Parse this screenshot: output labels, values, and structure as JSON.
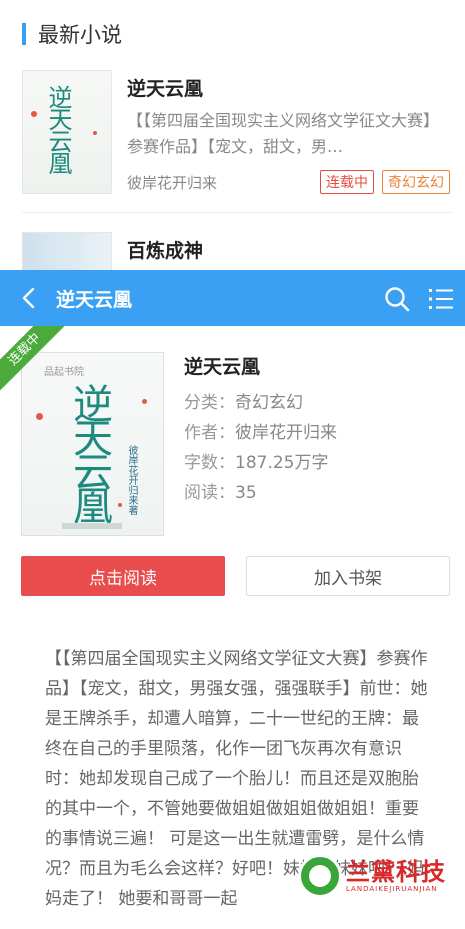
{
  "background": {
    "section_title": "最新小说",
    "books": [
      {
        "title": "逆天云凰",
        "cover_text": "逆天云凰",
        "description": "【【第四届全国现实主义网络文学征文大赛】参赛作品】【宠文，甜文，男…",
        "author": "彼岸花开归来",
        "tags": [
          "连载中",
          "奇幻玄幻"
        ]
      },
      {
        "title": "百炼成神"
      }
    ]
  },
  "header": {
    "title": "逆天云凰",
    "back_icon": "chevron-left-icon",
    "search_icon": "search-icon",
    "menu_icon": "list-menu-icon"
  },
  "detail": {
    "ribbon": "连载中",
    "cover": {
      "publisher": "品起书院",
      "title": "逆天云凰",
      "author": "彼岸花开归来著"
    },
    "title": "逆天云凰",
    "fields": [
      {
        "label": "分类：",
        "value": "奇幻玄幻"
      },
      {
        "label": "作者：",
        "value": "彼岸花开归来"
      },
      {
        "label": "字数：",
        "value": "187.25万字"
      },
      {
        "label": "阅读：",
        "value": "35"
      }
    ],
    "read_button": "点击阅读",
    "shelf_button": "加入书架",
    "summary": "【【第四届全国现实主义网络文学征文大赛】参赛作品】【宠文，甜文，男强女强，强强联手】前世：她是王牌杀手，却遭人暗算，二十一世纪的王牌：最终在自己的手里陨落，化作一团飞灰再次有意识时：她却发现自己成了一个胎儿！而且还是双胞胎的其中一个，不管她要做姐姐做姐姐做姐姐！重要的事情说三遍！ 可是这一出生就遭雷劈，是什么情况？而且为毛么会这样？好吧！妹妹就妹妹吧！ 妈妈走了！ 她要和哥哥一起"
  },
  "watermark": {
    "text": "兰黛科技",
    "sub": "LANDAIKEJIRUANJIAN"
  },
  "colors": {
    "accent": "#3aa0f3",
    "read_button": "#e84c4c",
    "ribbon": "#4caa3c",
    "tag_red": "#e74c3c",
    "tag_orange": "#e8843a"
  }
}
